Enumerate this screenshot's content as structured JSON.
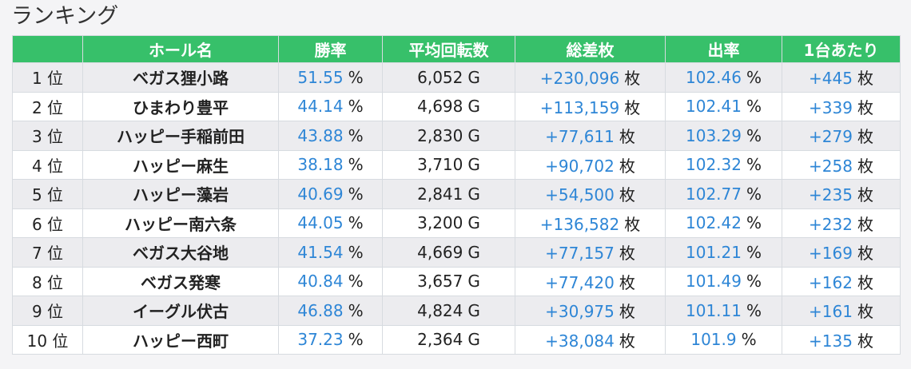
{
  "title": "ランキング",
  "headers": [
    "",
    "ホール名",
    "勝率",
    "平均回転数",
    "総差枚",
    "出率",
    "1台あたり"
  ],
  "units": {
    "rank": "位",
    "percent": "%",
    "games": "G",
    "coins": "枚"
  },
  "colors": {
    "header_bg": "#37c06a",
    "accent": "#2e86d6",
    "stripe": "#ececef"
  },
  "rows": [
    {
      "rank": "1",
      "hall": "ベガス狸小路",
      "win": "51.55",
      "spins": "6,052",
      "diff": "+230,096",
      "rate": "102.46",
      "per": "+445"
    },
    {
      "rank": "2",
      "hall": "ひまわり豊平",
      "win": "44.14",
      "spins": "4,698",
      "diff": "+113,159",
      "rate": "102.41",
      "per": "+339"
    },
    {
      "rank": "3",
      "hall": "ハッピー手稲前田",
      "win": "43.88",
      "spins": "2,830",
      "diff": "+77,611",
      "rate": "103.29",
      "per": "+279"
    },
    {
      "rank": "4",
      "hall": "ハッピー麻生",
      "win": "38.18",
      "spins": "3,710",
      "diff": "+90,702",
      "rate": "102.32",
      "per": "+258"
    },
    {
      "rank": "5",
      "hall": "ハッピー藻岩",
      "win": "40.69",
      "spins": "2,841",
      "diff": "+54,500",
      "rate": "102.77",
      "per": "+235"
    },
    {
      "rank": "6",
      "hall": "ハッピー南六条",
      "win": "44.05",
      "spins": "3,200",
      "diff": "+136,582",
      "rate": "102.42",
      "per": "+232"
    },
    {
      "rank": "7",
      "hall": "ベガス大谷地",
      "win": "41.54",
      "spins": "4,669",
      "diff": "+77,157",
      "rate": "101.21",
      "per": "+169"
    },
    {
      "rank": "8",
      "hall": "ベガス発寒",
      "win": "40.84",
      "spins": "3,657",
      "diff": "+77,420",
      "rate": "101.49",
      "per": "+162"
    },
    {
      "rank": "9",
      "hall": "イーグル伏古",
      "win": "46.88",
      "spins": "4,824",
      "diff": "+30,975",
      "rate": "101.11",
      "per": "+161"
    },
    {
      "rank": "10",
      "hall": "ハッピー西町",
      "win": "37.23",
      "spins": "2,364",
      "diff": "+38,084",
      "rate": "101.9",
      "per": "+135"
    }
  ]
}
